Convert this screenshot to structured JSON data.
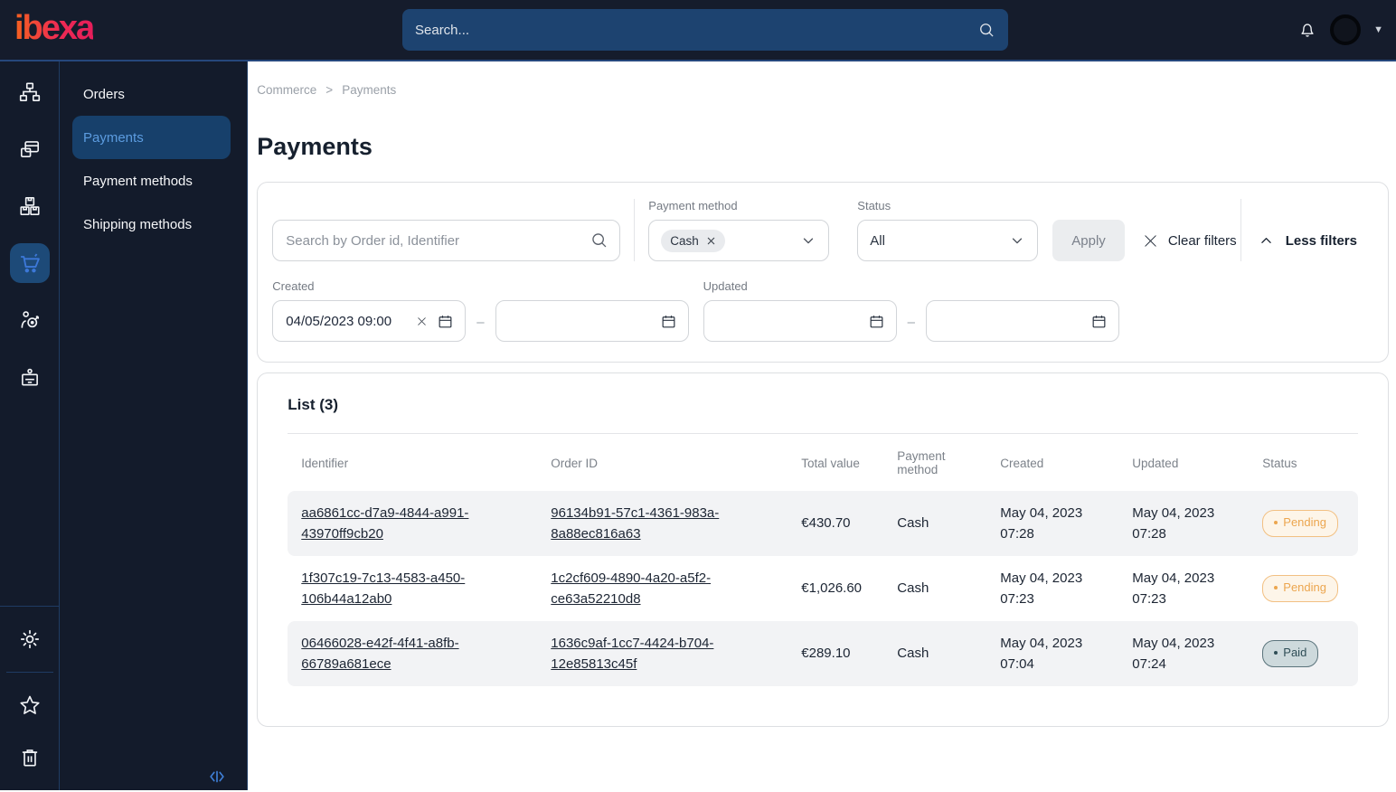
{
  "topbar": {
    "logo": "ibexa",
    "search_placeholder": "Search..."
  },
  "sidebar": {
    "rail_icons": [
      "content-tree-icon",
      "pages-icon",
      "products-icon",
      "commerce-cart-icon",
      "marketing-target-icon",
      "badge-icon",
      "settings-gear-icon",
      "favorites-star-icon",
      "trash-icon"
    ],
    "menu": {
      "items": [
        {
          "label": "Orders",
          "active": false
        },
        {
          "label": "Payments",
          "active": true
        },
        {
          "label": "Payment methods",
          "active": false
        },
        {
          "label": "Shipping methods",
          "active": false
        }
      ]
    }
  },
  "breadcrumb": {
    "separator": ">",
    "items": [
      {
        "label": "Commerce"
      },
      {
        "label": "Payments"
      }
    ]
  },
  "page": {
    "title": "Payments"
  },
  "filters": {
    "search_placeholder": "Search by Order id, Identifier",
    "payment_method": {
      "label": "Payment method",
      "chip": "Cash"
    },
    "status": {
      "label": "Status",
      "value": "All"
    },
    "apply_label": "Apply",
    "clear_label": "Clear filters",
    "less_label": "Less filters",
    "range_separator": "–",
    "created": {
      "label": "Created",
      "from": "04/05/2023 09:00",
      "to": ""
    },
    "updated": {
      "label": "Updated",
      "from": "",
      "to": ""
    }
  },
  "list": {
    "title": "List (3)",
    "columns": [
      "Identifier",
      "Order ID",
      "Total value",
      "Payment method",
      "Created",
      "Updated",
      "Status"
    ],
    "rows": [
      {
        "identifier": "aa6861cc-d7a9-4844-a991-43970ff9cb20",
        "order_id": "96134b91-57c1-4361-983a-8a88ec816a63",
        "total": "€430.70",
        "method": "Cash",
        "created": "May 04, 2023 07:28",
        "updated": "May 04, 2023 07:28",
        "status": "Pending"
      },
      {
        "identifier": "1f307c19-7c13-4583-a450-106b44a12ab0",
        "order_id": "1c2cf609-4890-4a20-a5f2-ce63a52210d8",
        "total": "€1,026.60",
        "method": "Cash",
        "created": "May 04, 2023 07:23",
        "updated": "May 04, 2023 07:23",
        "status": "Pending"
      },
      {
        "identifier": "06466028-e42f-4f41-a8fb-66789a681ece",
        "order_id": "1636c9af-1cc7-4424-b704-12e85813c45f",
        "total": "€289.10",
        "method": "Cash",
        "created": "May 04, 2023 07:04",
        "updated": "May 04, 2023 07:24",
        "status": "Paid"
      }
    ]
  },
  "colors": {
    "topbar_bg": "#151c2c",
    "accent_blue": "#3c78d8",
    "active_menu_bg": "#17406b",
    "active_menu_text": "#5c9ce0",
    "brand_gradient_start": "#f4611f",
    "brand_gradient_end": "#e61e5a",
    "pending_text": "#eca64f",
    "pending_bg": "#fdf5e9",
    "paid_text": "#2e4d56",
    "paid_bg": "#cdd9dc"
  }
}
